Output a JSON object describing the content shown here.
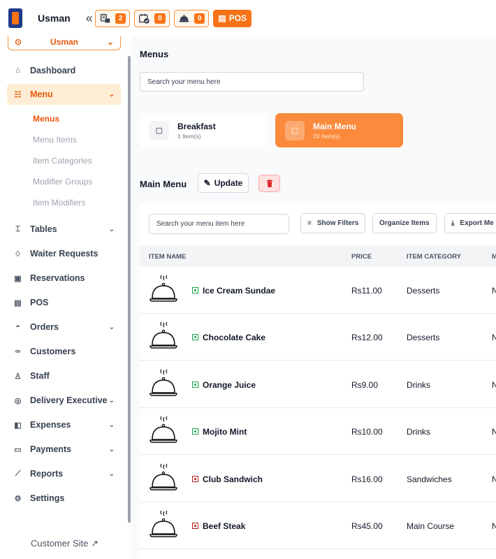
{
  "app": {
    "restaurant_name": "Usman",
    "collapse_icon": "double-chevron-left-icon",
    "toolbar": [
      {
        "icon": "table-icon",
        "count": "2"
      },
      {
        "icon": "calendar-check-icon",
        "count": "0"
      },
      {
        "icon": "waiter-bell-icon",
        "count": "0"
      }
    ],
    "pos_label": "POS"
  },
  "sidebar": {
    "branch": "Usman",
    "items": [
      {
        "label": "Dashboard",
        "icon": "home-icon"
      },
      {
        "label": "Menu",
        "icon": "menu-book-icon"
      },
      {
        "label": "Tables",
        "icon": "table-icon"
      },
      {
        "label": "Waiter Requests",
        "icon": "bell-icon"
      },
      {
        "label": "Reservations",
        "icon": "calendar-icon"
      },
      {
        "label": "POS",
        "icon": "pos-icon"
      },
      {
        "label": "Orders",
        "icon": "cloche-icon"
      },
      {
        "label": "Customers",
        "icon": "users-icon"
      },
      {
        "label": "Staff",
        "icon": "staff-icon"
      },
      {
        "label": "Delivery Executive",
        "icon": "delivery-icon"
      },
      {
        "label": "Expenses",
        "icon": "wallet-icon"
      },
      {
        "label": "Payments",
        "icon": "card-icon"
      },
      {
        "label": "Reports",
        "icon": "chart-icon"
      },
      {
        "label": "Settings",
        "icon": "gear-icon"
      }
    ],
    "menu_sub": [
      "Menus",
      "Menu Items",
      "Item Categories",
      "Modifier Groups",
      "Item Modifiers"
    ],
    "customer_site": "Customer Site"
  },
  "main": {
    "title": "Menus",
    "search_placeholder": "Search your menu here",
    "menus": [
      {
        "name": "Breakfast",
        "count": "1 Item(s)"
      },
      {
        "name": "Main Menu",
        "count": "20 Item(s)"
      }
    ],
    "section_title": "Main Menu",
    "update_label": "Update",
    "item_search_placeholder": "Search your menu item here",
    "show_filters": "Show Filters",
    "organize_items": "Organize Items",
    "export_label": "Export Me",
    "columns": {
      "name": "ITEM NAME",
      "price": "PRICE",
      "category": "ITEM CATEGORY",
      "cut": "M"
    },
    "items": [
      {
        "name": "Ice Cream Sundae",
        "price": "Rs11.00",
        "category": "Desserts",
        "cut": "N",
        "type": "veg"
      },
      {
        "name": "Chocolate Cake",
        "price": "Rs12.00",
        "category": "Desserts",
        "cut": "N",
        "type": "veg"
      },
      {
        "name": "Orange Juice",
        "price": "Rs9.00",
        "category": "Drinks",
        "cut": "N",
        "type": "veg"
      },
      {
        "name": "Mojito Mint",
        "price": "Rs10.00",
        "category": "Drinks",
        "cut": "N",
        "type": "veg"
      },
      {
        "name": "Club Sandwich",
        "price": "Rs16.00",
        "category": "Sandwiches",
        "cut": "N",
        "type": "nonveg"
      },
      {
        "name": "Beef Steak",
        "price": "Rs45.00",
        "category": "Main Course",
        "cut": "N",
        "type": "nonveg"
      }
    ]
  },
  "colors": {
    "accent": "#f97316",
    "veg": "#16a34a",
    "nonveg": "#b91c1c"
  }
}
